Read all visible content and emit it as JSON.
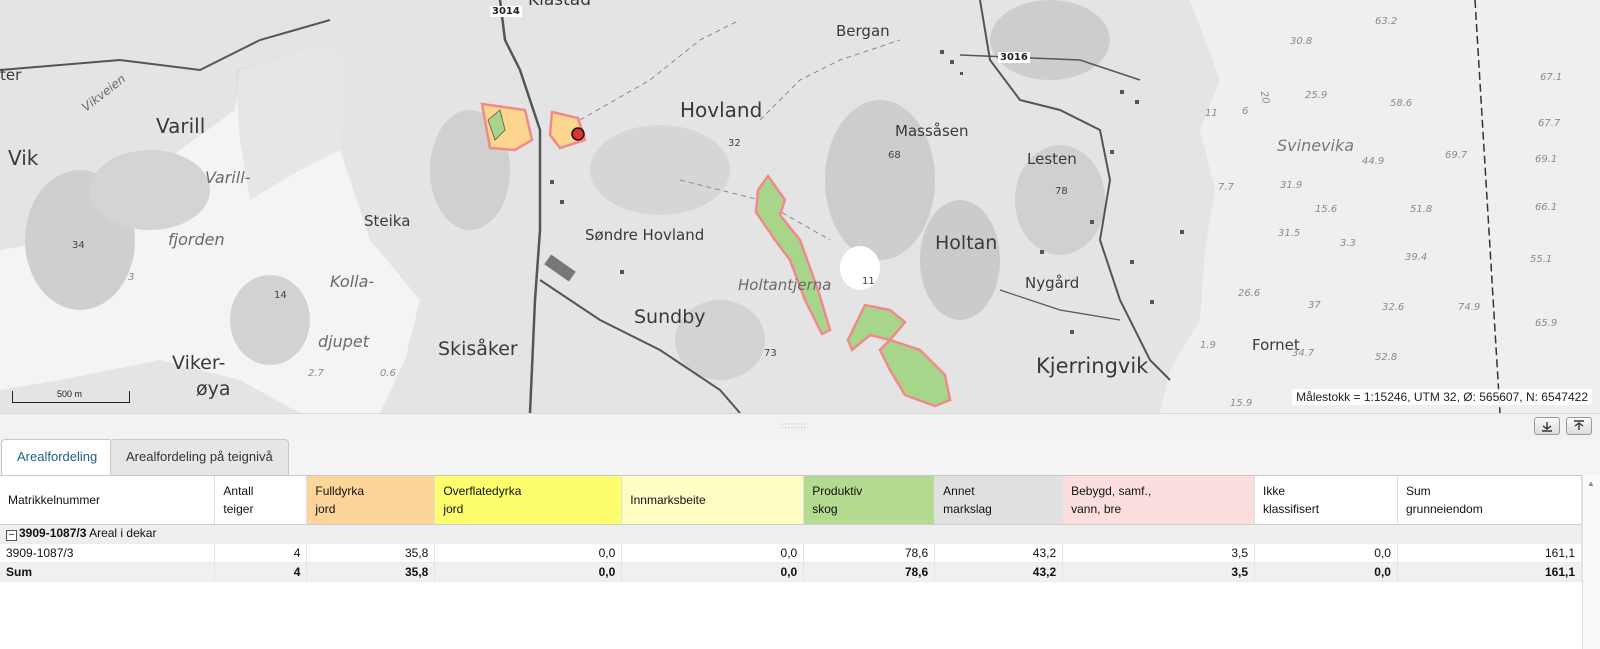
{
  "map": {
    "places": [
      {
        "text": "Klastad",
        "style": "normal"
      },
      {
        "text": "Bergan",
        "style": "normal"
      },
      {
        "text": "Varill",
        "style": "normal"
      },
      {
        "text": "Vik",
        "style": "normal"
      },
      {
        "text": "Hovland",
        "style": "normal"
      },
      {
        "text": "Massåsen",
        "style": "normal"
      },
      {
        "text": "Lesten",
        "style": "normal"
      },
      {
        "text": "Varill-",
        "style": "italic"
      },
      {
        "text": "fjorden",
        "style": "italic"
      },
      {
        "text": "Steika",
        "style": "normal"
      },
      {
        "text": "Søndre Hovland",
        "style": "normal"
      },
      {
        "text": "Holtan",
        "style": "normal"
      },
      {
        "text": "Kolla-",
        "style": "italic"
      },
      {
        "text": "djupet",
        "style": "italic"
      },
      {
        "text": "Holtantjerna",
        "style": "italic"
      },
      {
        "text": "Nygård",
        "style": "normal"
      },
      {
        "text": "Sundby",
        "style": "normal"
      },
      {
        "text": "Skisåker",
        "style": "normal"
      },
      {
        "text": "Viker-",
        "style": "normal"
      },
      {
        "text": "øya",
        "style": "normal"
      },
      {
        "text": "Kjerringvik",
        "style": "normal"
      },
      {
        "text": "Fornet",
        "style": "normal"
      },
      {
        "text": "Svinevika",
        "style": "sea"
      },
      {
        "text": "Vikveien",
        "style": "italic"
      },
      {
        "text": "ter",
        "style": "normal"
      }
    ],
    "heights": [
      "32",
      "68",
      "78",
      "34",
      "14",
      "11",
      "73",
      "2.7",
      "0.6",
      "3"
    ],
    "depths": [
      "63.2",
      "30.8",
      "67.1",
      "25.9",
      "58.6",
      "67.7",
      "44.9",
      "69.7",
      "69.1",
      "31.9",
      "15.6",
      "51.8",
      "66.1",
      "31.5",
      "3.3",
      "39.4",
      "55.1",
      "26.6",
      "37",
      "32.6",
      "74.9",
      "65.9",
      "34.7",
      "52.8",
      "15.9",
      "1.9",
      "7.7",
      "6",
      "11",
      "20"
    ],
    "road_numbers": [
      "3014",
      "3016"
    ],
    "scale_bar_label": "500 m",
    "scale_info": "Målestokk = 1:15246, UTM 32, Ø: 565607, N: 6547422",
    "colors": {
      "parcel_fill": "#fcd58e",
      "parcel_border": "#f08a8a",
      "forest_fill": "#a7d68a",
      "marker": "#e03030"
    }
  },
  "panel": {
    "grip": "::::::::",
    "collapse_icon": "collapse-down-icon",
    "expand_icon": "expand-up-icon"
  },
  "tabs": [
    {
      "label": "Arealfordeling",
      "active": true
    },
    {
      "label": "Arealfordeling på teignivå",
      "active": false
    }
  ],
  "table": {
    "columns": [
      {
        "line1": "Matrikkelnummer",
        "line2": "",
        "color": "#ffffff"
      },
      {
        "line1": "Antall",
        "line2": "teiger",
        "color": "#ffffff"
      },
      {
        "line1": "Fulldyrka",
        "line2": "jord",
        "color": "#fdd59a"
      },
      {
        "line1": "Overflatedyrka",
        "line2": "jord",
        "color": "#fdfd6e"
      },
      {
        "line1": "Innmarksbeite",
        "line2": "",
        "color": "#fdfdc4"
      },
      {
        "line1": "Produktiv",
        "line2": "skog",
        "color": "#b4da8f"
      },
      {
        "line1": "Annet",
        "line2": "markslag",
        "color": "#e0e0e0"
      },
      {
        "line1": "Bebygd, samf.,",
        "line2": "vann, bre",
        "color": "#fbdede"
      },
      {
        "line1": "Ikke",
        "line2": "klassifisert",
        "color": "#ffffff"
      },
      {
        "line1": "Sum",
        "line2": "grunneiendom",
        "color": "#ffffff"
      }
    ],
    "group": {
      "expander": "−",
      "id": "3909-1087/3",
      "label": "Areal i dekar"
    },
    "rows": [
      [
        "3909-1087/3",
        "4",
        "35,8",
        "0,0",
        "0,0",
        "78,6",
        "43,2",
        "3,5",
        "0,0",
        "161,1"
      ]
    ],
    "sum": [
      "Sum",
      "4",
      "35,8",
      "0,0",
      "0,0",
      "78,6",
      "43,2",
      "3,5",
      "0,0",
      "161,1"
    ]
  },
  "scrollbar": {
    "arrow": "▲"
  }
}
